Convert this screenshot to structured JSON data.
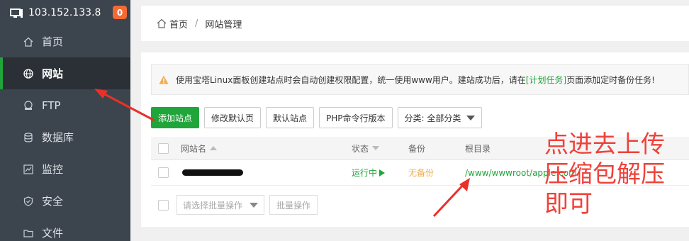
{
  "server": {
    "ip": "103.152.133.8",
    "badge": "0"
  },
  "sidebar": {
    "items": [
      {
        "label": "首页",
        "icon": "home-icon"
      },
      {
        "label": "网站",
        "icon": "globe-icon",
        "active": true
      },
      {
        "label": "FTP",
        "icon": "ftp-icon"
      },
      {
        "label": "数据库",
        "icon": "database-icon"
      },
      {
        "label": "监控",
        "icon": "monitor-chart-icon"
      },
      {
        "label": "安全",
        "icon": "shield-icon"
      },
      {
        "label": "文件",
        "icon": "folder-icon"
      }
    ]
  },
  "breadcrumb": {
    "home": "首页",
    "sep": "/",
    "current": "网站管理"
  },
  "alert": {
    "text_before": "使用宝塔Linux面板创建站点时会自动创建权限配置，统一使用www用户。建站成功后，请在",
    "link": "[计划任务]",
    "text_after": "页面添加定时备份任务!"
  },
  "toolbar": {
    "add_site": "添加站点",
    "edit_default_page": "修改默认页",
    "default_site": "默认站点",
    "php_cli": "PHP命令行版本",
    "category": "分类: 全部分类"
  },
  "table": {
    "headers": {
      "name": "网站名",
      "status": "状态",
      "backup": "备份",
      "root": "根目录"
    },
    "rows": [
      {
        "status": "运行中",
        "backup": "无备份",
        "root": "/www/wwwroot/apple.com"
      }
    ]
  },
  "batch": {
    "select_placeholder": "请选择批量操作",
    "button": "批量操作"
  },
  "annotation": {
    "lines": [
      "点进去上传",
      "压缩包解压",
      "即可"
    ]
  },
  "colors": {
    "accent": "#20a53a",
    "sidebar": "#3c444d",
    "annotation": "#f0413a",
    "badge": "#f36a35"
  }
}
